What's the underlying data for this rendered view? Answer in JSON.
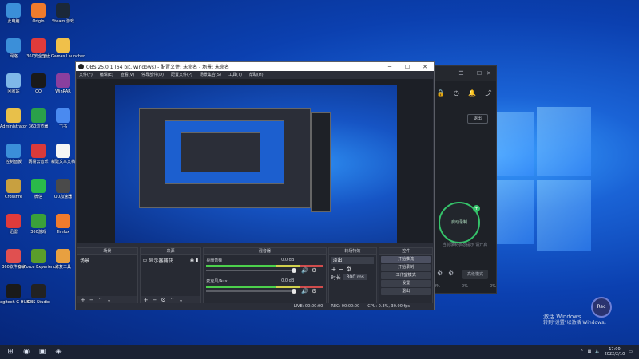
{
  "desktop": {
    "icons": [
      {
        "label": "此电脑",
        "icon": "computer-icon",
        "color": "#3b8fd9"
      },
      {
        "label": "Origin",
        "icon": "origin-icon",
        "color": "#f07b2c"
      },
      {
        "label": "Steam 游戏",
        "icon": "steam-icon",
        "color": "#1b2838"
      },
      {
        "label": "网络",
        "icon": "network-icon",
        "color": "#3b8fd9"
      },
      {
        "label": "360安全卫士",
        "icon": "360-icon",
        "color": "#e03b3b"
      },
      {
        "label": "Epic Games Launcher",
        "icon": "epic-icon",
        "color": "#f0c04a"
      },
      {
        "label": "回收站",
        "icon": "recycle-bin-icon",
        "color": "#7fb8e8"
      },
      {
        "label": "QQ",
        "icon": "qq-icon",
        "color": "#1a1a1a"
      },
      {
        "label": "WinRAR",
        "icon": "winrar-icon",
        "color": "#8a3f9e"
      },
      {
        "label": "Administrator",
        "icon": "user-folder-icon",
        "color": "#e8c04a"
      },
      {
        "label": "360浏览器",
        "icon": "browser-icon",
        "color": "#2aa04a"
      },
      {
        "label": "飞书",
        "icon": "feishu-icon",
        "color": "#4a8af0"
      },
      {
        "label": "控制面板",
        "icon": "control-panel-icon",
        "color": "#3b8fd9"
      },
      {
        "label": "网易云音乐",
        "icon": "netease-music-icon",
        "color": "#d93a3a"
      },
      {
        "label": "新建文本文档",
        "icon": "text-file-icon",
        "color": "#f5f5f5"
      },
      {
        "label": "Crossfire",
        "icon": "crossfire-icon",
        "color": "#c8a040"
      },
      {
        "label": "微信",
        "icon": "wechat-icon",
        "color": "#2aba4a"
      },
      {
        "label": "UU加速器",
        "icon": "uu-icon",
        "color": "#4a4a4a"
      },
      {
        "label": "迅雷",
        "icon": "xunlei-icon",
        "color": "#e03b3b"
      },
      {
        "label": "360游戏",
        "icon": "game-icon",
        "color": "#3aa03a"
      },
      {
        "label": "Firefox",
        "icon": "firefox-icon",
        "color": "#f07b2c"
      },
      {
        "label": "360软件管家",
        "icon": "software-manager-icon",
        "color": "#e05050"
      },
      {
        "label": "GeForce Experience",
        "icon": "nvidia-icon",
        "color": "#5a9e2a"
      },
      {
        "label": "修复工具",
        "icon": "repair-tool-icon",
        "color": "#e8a040"
      },
      {
        "label": "Logitech G HUB",
        "icon": "logitech-icon",
        "color": "#1a1a1a"
      },
      {
        "label": "OBS Studio",
        "icon": "obs-icon",
        "color": "#222222"
      }
    ]
  },
  "obs": {
    "title": "OBS 25.0.1 (64 bit, windows) - 配置文件: 未命名 - 场景: 未命名",
    "window_controls": [
      "─",
      "☐",
      "✕"
    ],
    "menu": [
      "文件(F)",
      "编辑(E)",
      "查看(V)",
      "停靠部件(D)",
      "配置文件(P)",
      "场景集合(S)",
      "工具(T)",
      "帮助(H)"
    ],
    "docks": {
      "scenes": {
        "title": "场景",
        "items": [
          "场景"
        ]
      },
      "sources": {
        "title": "来源",
        "items": [
          "显示器捕获"
        ]
      },
      "mixer": {
        "title": "混音器",
        "channels": [
          {
            "name": "桌面音频",
            "value": "0.0 dB",
            "level": 0.65
          },
          {
            "name": "麦克风/Aux",
            "value": "0.0 dB",
            "level": 0.55
          }
        ]
      },
      "transitions": {
        "title": "转场特效",
        "type": "淡出",
        "duration_label": "时长",
        "duration_value": "300 ms"
      },
      "controls": {
        "title": "控件",
        "buttons": [
          "开始推流",
          "开始录制",
          "工作室模式",
          "设置",
          "退出"
        ]
      }
    },
    "status": {
      "live": "LIVE: 00:00:00",
      "rec": "REC: 00:00:00",
      "cpu": "CPU: 0.3%, 30.00 fps"
    }
  },
  "darkapp": {
    "exit_label": "退出",
    "ring_label": "启动录制",
    "hint": "当前录制状态提示 请开启",
    "button_label": "高级模式",
    "stats": [
      "0%",
      "0%",
      "0%"
    ]
  },
  "activation": {
    "line1": "激活 Windows",
    "line2": "转到\"设置\"以激活 Windows。"
  },
  "rec_badge": {
    "label": "Rec"
  },
  "taskbar": {
    "time": "17:00",
    "date": "2022/2/10"
  }
}
